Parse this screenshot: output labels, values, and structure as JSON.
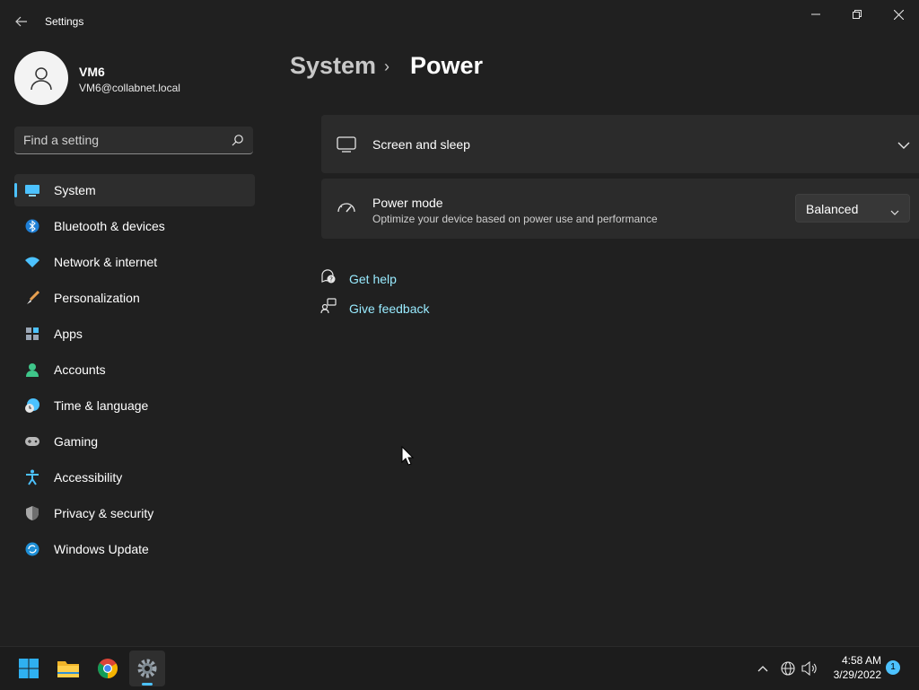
{
  "window": {
    "title": "Settings",
    "controls": [
      "minimize",
      "restore",
      "close"
    ]
  },
  "profile": {
    "name": "VM6",
    "email": "VM6@collabnet.local"
  },
  "search": {
    "placeholder": "Find a setting",
    "value": ""
  },
  "sidebar": {
    "items": [
      {
        "label": "System",
        "icon": "system-icon",
        "selected": true
      },
      {
        "label": "Bluetooth & devices",
        "icon": "bluetooth-icon"
      },
      {
        "label": "Network & internet",
        "icon": "wifi-icon"
      },
      {
        "label": "Personalization",
        "icon": "brush-icon"
      },
      {
        "label": "Apps",
        "icon": "apps-icon"
      },
      {
        "label": "Accounts",
        "icon": "account-icon"
      },
      {
        "label": "Time & language",
        "icon": "clock-globe-icon"
      },
      {
        "label": "Gaming",
        "icon": "gamepad-icon"
      },
      {
        "label": "Accessibility",
        "icon": "accessibility-icon"
      },
      {
        "label": "Privacy & security",
        "icon": "shield-icon"
      },
      {
        "label": "Windows Update",
        "icon": "update-icon"
      }
    ]
  },
  "breadcrumb": {
    "parent": "System",
    "separator": "›",
    "current": "Power"
  },
  "cards": {
    "screen_sleep": {
      "title": "Screen and sleep",
      "expanded": false
    },
    "power_mode": {
      "title": "Power mode",
      "subtitle": "Optimize your device based on power use and performance",
      "selected": "Balanced"
    }
  },
  "links": {
    "get_help": "Get help",
    "give_feedback": "Give feedback"
  },
  "taskbar": {
    "apps": [
      "start-icon",
      "file-explorer-icon",
      "chrome-icon",
      "settings-icon"
    ],
    "active_app": "settings-icon",
    "time": "4:58 AM",
    "date": "3/29/2022",
    "notification_count": "1"
  },
  "colors": {
    "background": "#202020",
    "card": "#2b2b2b",
    "accent": "#4cc2ff",
    "link": "#99ebff",
    "taskbar": "#1c1c1c"
  }
}
